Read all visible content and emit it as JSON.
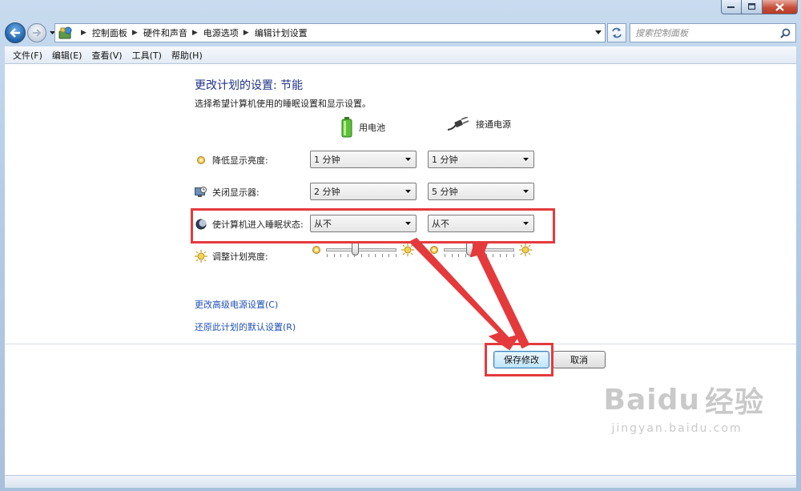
{
  "breadcrumb": [
    "控制面板",
    "硬件和声音",
    "电源选项",
    "编辑计划设置"
  ],
  "search": {
    "placeholder": "搜索控制面板"
  },
  "menu": [
    "文件(F)",
    "编辑(E)",
    "查看(V)",
    "工具(T)",
    "帮助(H)"
  ],
  "page": {
    "title": "更改计划的设置: 节能",
    "description": "选择希望计算机使用的睡眠设置和显示设置。"
  },
  "columns": {
    "battery": "用电池",
    "plugged": "接通电源"
  },
  "settings": {
    "dim_display": {
      "label": "降低显示亮度:",
      "battery": "1 分钟",
      "plugged": "1 分钟"
    },
    "turn_off_display": {
      "label": "关闭显示器:",
      "battery": "2 分钟",
      "plugged": "5 分钟"
    },
    "sleep": {
      "label": "使计算机进入睡眠状态:",
      "battery": "从不",
      "plugged": "从不"
    },
    "brightness": {
      "label": "调整计划亮度:",
      "battery_level": 0.4,
      "plugged_level": 0.35
    }
  },
  "links": {
    "advanced": "更改高级电源设置(C)",
    "restore": "还原此计划的默认设置(R)"
  },
  "buttons": {
    "save": "保存修改",
    "cancel": "取消"
  },
  "watermark": {
    "brand": "Baidu",
    "brand_cn": "经验",
    "url": "jingyan.baidu.com"
  },
  "colors": {
    "highlight": "#e43a3c",
    "link": "#1f4fb8",
    "title": "#1e3287"
  },
  "icons": [
    "back-arrow-icon",
    "forward-arrow-icon",
    "control-panel-icon",
    "refresh-icon",
    "search-icon",
    "battery-icon",
    "power-plug-icon",
    "dim-sun-icon",
    "monitor-clock-icon",
    "sleep-moon-icon",
    "brightness-sun-icon"
  ]
}
